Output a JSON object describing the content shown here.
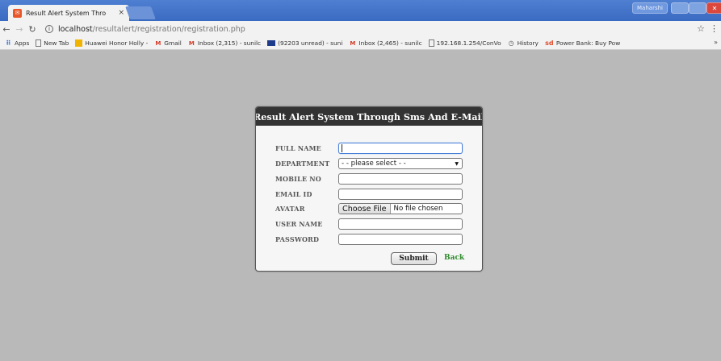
{
  "browser": {
    "tab_title": "Result Alert System Thro",
    "tab_close": "×",
    "user_button": "Maharshi",
    "url_host": "localhost",
    "url_path": "/resultalert/registration/registration.php",
    "bookmarks": [
      {
        "label": "Apps",
        "icon": "apps-icon"
      },
      {
        "label": "New Tab",
        "icon": "page-icon"
      },
      {
        "label": "Huawei Honor Holly -",
        "icon": "huawei-icon"
      },
      {
        "label": "Gmail",
        "icon": "gmail-icon"
      },
      {
        "label": "Inbox (2,315) - sunilc",
        "icon": "gmail-icon"
      },
      {
        "label": "(92203 unread) - suni",
        "icon": "mail-icon"
      },
      {
        "label": "Inbox (2,465) - sunilc",
        "icon": "gmail-icon"
      },
      {
        "label": "192.168.1.254/ConVo",
        "icon": "page-icon"
      },
      {
        "label": "History",
        "icon": "history-icon"
      },
      {
        "label": "Power Bank: Buy Pow",
        "icon": "sd-icon"
      }
    ]
  },
  "form": {
    "title": "Result Alert System Through Sms And E-Mail",
    "labels": {
      "full_name": "FULL NAME",
      "department": "DEPARTMENT",
      "mobile": "MOBILE NO",
      "email": "EMAIL ID",
      "avatar": "AVATAR",
      "username": "USER NAME",
      "password": "PASSWORD"
    },
    "values": {
      "full_name": "",
      "department": "- - please select - -",
      "mobile": "",
      "email": "",
      "username": "",
      "password": ""
    },
    "file_button": "Choose File",
    "file_status": "No file chosen",
    "submit": "Submit",
    "back": "Back"
  },
  "colors": {
    "page_background": "#b9b9b9",
    "header_background": "#333333",
    "back_link": "#2e8b2e"
  }
}
